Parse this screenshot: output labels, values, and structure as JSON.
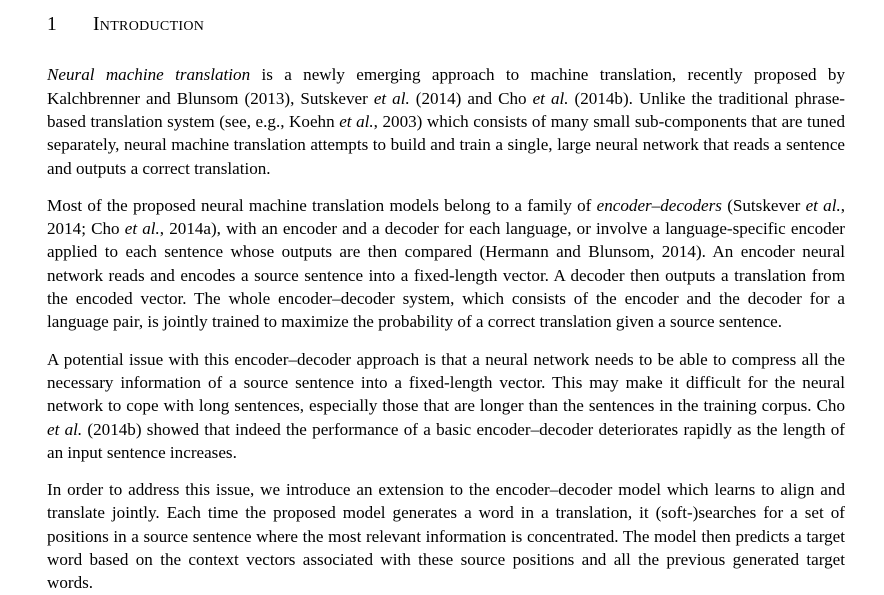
{
  "document": {
    "section": {
      "number": "1",
      "title": "Introduction"
    },
    "paragraphs": [
      {
        "id": "p1",
        "segments": [
          {
            "style": "italic",
            "text": "Neural machine translation"
          },
          {
            "style": "normal",
            "text": " is a newly emerging approach to machine translation, recently proposed by Kalchbrenner and Blunsom (2013), Sutskever "
          },
          {
            "style": "italic",
            "text": "et al."
          },
          {
            "style": "normal",
            "text": " (2014) and Cho "
          },
          {
            "style": "italic",
            "text": "et al."
          },
          {
            "style": "normal",
            "text": " (2014b). Unlike the traditional phrase-based translation system (see, e.g., Koehn "
          },
          {
            "style": "italic",
            "text": "et al."
          },
          {
            "style": "normal",
            "text": ", 2003) which consists of many small sub-components that are tuned separately, neural machine translation attempts to build and train a single, large neural network that reads a sentence and outputs a correct translation."
          }
        ],
        "plain": "Neural machine translation is a newly emerging approach to machine translation, recently proposed by Kalchbrenner and Blunsom (2013), Sutskever et al. (2014) and Cho et al. (2014b). Unlike the traditional phrase-based translation system (see, e.g., Koehn et al., 2003) which consists of many small sub-components that are tuned separately, neural machine translation attempts to build and train a single, large neural network that reads a sentence and outputs a correct translation."
      },
      {
        "id": "p2",
        "segments": [
          {
            "style": "normal",
            "text": "Most of the proposed neural machine translation models belong to a family of "
          },
          {
            "style": "italic",
            "text": "encoder–decoders"
          },
          {
            "style": "normal",
            "text": " (Sutskever "
          },
          {
            "style": "italic",
            "text": "et al."
          },
          {
            "style": "normal",
            "text": ", 2014; Cho "
          },
          {
            "style": "italic",
            "text": "et al."
          },
          {
            "style": "normal",
            "text": ", 2014a), with an encoder and a decoder for each language, or involve a language-specific encoder applied to each sentence whose outputs are then compared (Hermann and Blunsom, 2014). An encoder neural network reads and encodes a source sentence into a fixed-length vector. A decoder then outputs a translation from the encoded vector. The whole encoder–decoder system, which consists of the encoder and the decoder for a language pair, is jointly trained to maximize the probability of a correct translation given a source sentence."
          }
        ],
        "plain": "Most of the proposed neural machine translation models belong to a family of encoder–decoders (Sutskever et al., 2014; Cho et al., 2014a), with an encoder and a decoder for each language, or involve a language-specific encoder applied to each sentence whose outputs are then compared (Hermann and Blunsom, 2014). An encoder neural network reads and encodes a source sentence into a fixed-length vector. A decoder then outputs a translation from the encoded vector. The whole encoder–decoder system, which consists of the encoder and the decoder for a language pair, is jointly trained to maximize the probability of a correct translation given a source sentence."
      },
      {
        "id": "p3",
        "segments": [
          {
            "style": "normal",
            "text": "A potential issue with this encoder–decoder approach is that a neural network needs to be able to compress all the necessary information of a source sentence into a fixed-length vector. This may make it difficult for the neural network to cope with long sentences, especially those that are longer than the sentences in the training corpus. Cho "
          },
          {
            "style": "italic",
            "text": "et al."
          },
          {
            "style": "normal",
            "text": " (2014b) showed that indeed the performance of a basic encoder–decoder deteriorates rapidly as the length of an input sentence increases."
          }
        ],
        "plain": "A potential issue with this encoder–decoder approach is that a neural network needs to be able to compress all the necessary information of a source sentence into a fixed-length vector. This may make it difficult for the neural network to cope with long sentences, especially those that are longer than the sentences in the training corpus. Cho et al. (2014b) showed that indeed the performance of a basic encoder–decoder deteriorates rapidly as the length of an input sentence increases."
      },
      {
        "id": "p4",
        "segments": [
          {
            "style": "normal",
            "text": "In order to address this issue, we introduce an extension to the encoder–decoder model which learns to align and translate jointly. Each time the proposed model generates a word in a translation, it (soft-)searches for a set of positions in a source sentence where the most relevant information is concentrated. The model then predicts a target word based on the context vectors associated with these source positions and all the previous generated target words."
          }
        ],
        "plain": "In order to address this issue, we introduce an extension to the encoder–decoder model which learns to align and translate jointly. Each time the proposed model generates a word in a translation, it (soft-)searches for a set of positions in a source sentence where the most relevant information is concentrated. The model then predicts a target word based on the context vectors associated with these source positions and all the previous generated target words."
      }
    ]
  },
  "colors": {
    "page_background": "#ffffff",
    "text": "#000000"
  }
}
